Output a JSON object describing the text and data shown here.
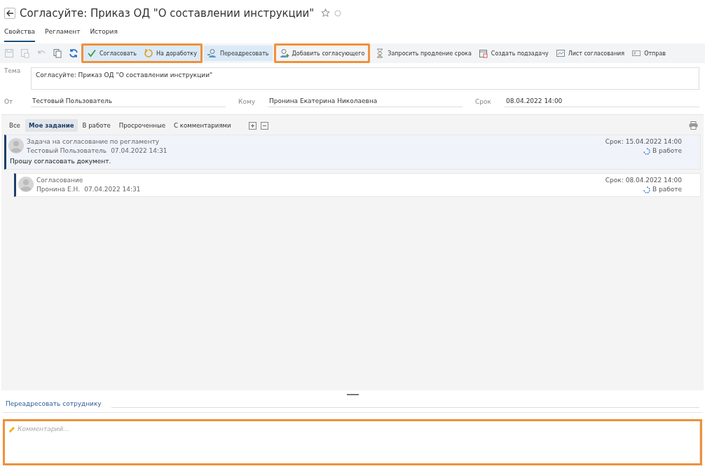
{
  "header": {
    "title": "Согласуйте: Приказ ОД \"О составлении инструкции\""
  },
  "tabs": [
    {
      "label": "Свойства",
      "selected": true
    },
    {
      "label": "Регламент",
      "selected": false
    },
    {
      "label": "История",
      "selected": false
    }
  ],
  "toolbar": {
    "icon_buttons": [
      {
        "kind": "save",
        "disabled": true
      },
      {
        "kind": "save-as",
        "disabled": true
      },
      {
        "kind": "undo",
        "disabled": true
      },
      {
        "kind": "copy",
        "disabled": false
      },
      {
        "kind": "refresh",
        "disabled": false
      }
    ],
    "groups": [
      {
        "highlighted": true,
        "buttons": [
          {
            "kind": "check",
            "label": "Согласовать",
            "emphasis": true
          },
          {
            "kind": "rework",
            "label": "На доработку",
            "emphasis": true
          }
        ]
      },
      {
        "highlighted": false,
        "buttons": [
          {
            "kind": "person",
            "label": "Переадресовать",
            "emphasis": true
          }
        ]
      },
      {
        "highlighted": true,
        "buttons": [
          {
            "kind": "add-person",
            "label": "Добавить согласующего",
            "emphasis": false
          }
        ]
      },
      {
        "highlighted": false,
        "buttons": [
          {
            "kind": "hourglass",
            "label": "Запросить продление срока",
            "emphasis": false
          },
          {
            "kind": "subtask",
            "label": "Создать подзадачу",
            "emphasis": false
          },
          {
            "kind": "sheet",
            "label": "Лист согласования",
            "emphasis": false
          },
          {
            "kind": "send",
            "label": "Отправ",
            "emphasis": false
          }
        ]
      }
    ]
  },
  "form": {
    "subject": {
      "label": "Тема",
      "value": "Согласуйте: Приказ ОД \"О составлении инструкции\""
    },
    "from": {
      "label": "От",
      "value": "Тестовый Пользователь"
    },
    "to": {
      "label": "Кому",
      "value": "Пронина Екатерина Николаевна"
    },
    "due": {
      "label": "Срок",
      "value": "08.04.2022 14:00"
    }
  },
  "filters": [
    {
      "label": "Все",
      "selected": false
    },
    {
      "label": "Мое задание",
      "selected": true
    },
    {
      "label": "В работе",
      "selected": false
    },
    {
      "label": "Просроченные",
      "selected": false
    },
    {
      "label": "С комментариями",
      "selected": false
    }
  ],
  "tasks": [
    {
      "title": "Задача на согласование по регламенту",
      "author": "Тестовый Пользователь",
      "date": "07.04.2022 14:31",
      "due": "Срок: 15.04.2022 14:00",
      "status": "В работе",
      "comment": "Прошу согласовать документ.",
      "current": true,
      "children": [
        {
          "title": "Согласование",
          "author": "Пронина Е.Н.",
          "date": "07.04.2022 14:31",
          "due": "Срок: 08.04.2022 14:00",
          "status": "В работе",
          "current": false
        }
      ]
    }
  ],
  "redirect": {
    "label": "Переадресовать сотруднику"
  },
  "comment": {
    "placeholder": "Комментарий...",
    "highlighted": true
  }
}
